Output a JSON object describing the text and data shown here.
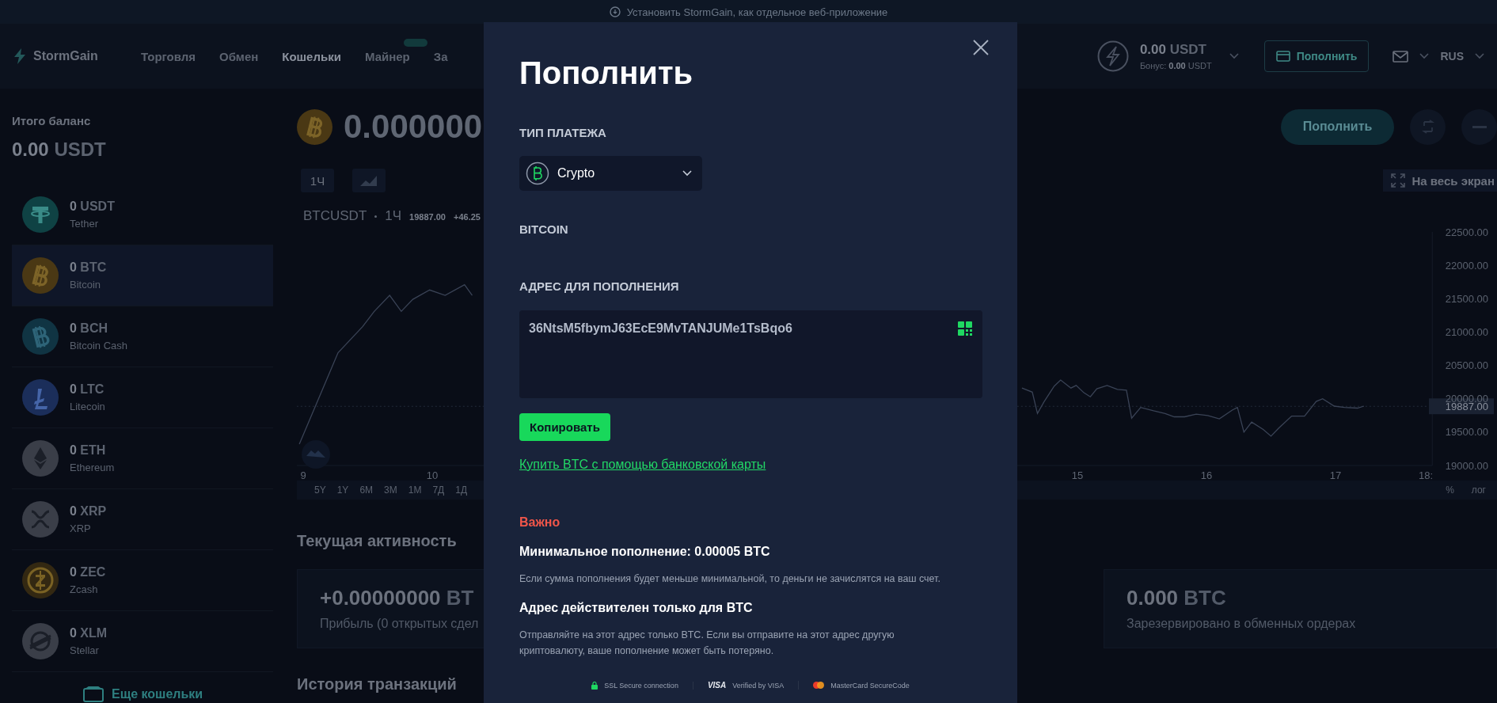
{
  "install_banner": {
    "text": "Установить StormGain, как отдельное веб-приложение"
  },
  "header": {
    "logo": "StormGain",
    "nav": [
      {
        "label": "Торговля",
        "selected": false,
        "badge": false
      },
      {
        "label": "Обмен",
        "selected": false,
        "badge": false
      },
      {
        "label": "Кошельки",
        "selected": true,
        "badge": false
      },
      {
        "label": "Майнер",
        "selected": false,
        "badge": true
      },
      {
        "label": "За",
        "selected": false,
        "badge": false
      }
    ],
    "balance": {
      "amount": "0.00",
      "currency": "USDT",
      "bonus_label": "Бонус:",
      "bonus_amount": "0.00",
      "bonus_currency": "USDT"
    },
    "deposit_button": "Пополнить",
    "language": "RUS"
  },
  "sidebar": {
    "title": "Итого баланс",
    "total_amount": "0.00",
    "total_currency": "USDT",
    "wallets": [
      {
        "amount": "0",
        "symbol": "USDT",
        "name": "Tether",
        "kind": "usdt",
        "selected": false
      },
      {
        "amount": "0",
        "symbol": "BTC",
        "name": "Bitcoin",
        "kind": "btc",
        "selected": true
      },
      {
        "amount": "0",
        "symbol": "BCH",
        "name": "Bitcoin Cash",
        "kind": "bch",
        "selected": false
      },
      {
        "amount": "0",
        "symbol": "LTC",
        "name": "Litecoin",
        "kind": "ltc",
        "selected": false
      },
      {
        "amount": "0",
        "symbol": "ETH",
        "name": "Ethereum",
        "kind": "eth",
        "selected": false
      },
      {
        "amount": "0",
        "symbol": "XRP",
        "name": "XRP",
        "kind": "xrp",
        "selected": false
      },
      {
        "amount": "0",
        "symbol": "ZEC",
        "name": "Zcash",
        "kind": "zec",
        "selected": false
      },
      {
        "amount": "0",
        "symbol": "XLM",
        "name": "Stellar",
        "kind": "xlm",
        "selected": false
      }
    ],
    "more_link": "Еще кошельки"
  },
  "main": {
    "asset_amount": "0.000000",
    "deposit_button": "Пополнить",
    "interval_tab": "1Ч",
    "fullscreen_button": "На весь экран",
    "chart_symbol": "BTCUSDT",
    "chart_interval": "1Ч",
    "chart_price": "19887.00",
    "chart_change": "+46.25",
    "chart_data": {
      "type": "line",
      "xlim": [
        8.95,
        17.75
      ],
      "ylim": [
        19000,
        22500
      ],
      "xticks": [
        9,
        10,
        15,
        16,
        17,
        {
          "value": 17.7,
          "label": "18:"
        }
      ],
      "yticks": [
        {
          "value": 19000,
          "label": "19000.00"
        },
        {
          "value": 19500,
          "label": "19500.00"
        },
        {
          "value": 20000,
          "label": "20000.00"
        },
        {
          "value": 20500,
          "label": "20500.00"
        },
        {
          "value": 21000,
          "label": "21000.00"
        },
        {
          "value": 21500,
          "label": "21500.00"
        },
        {
          "value": 22000,
          "label": "22000.00"
        },
        {
          "value": 22500,
          "label": "22500.00"
        }
      ],
      "x": [
        8.97,
        9.2,
        9.27,
        9.46,
        9.55,
        9.67,
        9.76,
        9.85,
        9.98,
        10.1,
        10.25,
        10.31,
        14.57,
        14.65,
        14.69,
        14.74,
        14.82,
        14.87,
        14.95,
        14.99,
        15.05,
        15.1,
        15.15,
        15.23,
        15.31,
        15.38,
        15.42,
        15.49,
        15.59,
        15.68,
        15.75,
        15.83,
        15.92,
        16.01,
        16.1,
        16.2,
        16.24,
        16.29,
        16.35,
        16.44,
        16.5,
        16.56,
        16.66,
        16.76,
        16.85,
        16.9,
        16.99,
        17.07,
        17.17,
        17.22
      ],
      "series": [
        {
          "color": "#3a4356",
          "values": [
            19320,
            20370,
            20690,
            21080,
            21310,
            21550,
            21310,
            21490,
            21630,
            21550,
            21710,
            21550,
            20160,
            20100,
            19780,
            19950,
            20190,
            20280,
            20160,
            20200,
            20090,
            20030,
            20150,
            20200,
            20140,
            20130,
            19710,
            19870,
            19820,
            19780,
            19730,
            19730,
            19770,
            19750,
            19700,
            19830,
            19870,
            19500,
            19650,
            19540,
            19440,
            19560,
            19740,
            19740,
            19960,
            20000,
            19890,
            19870,
            19860,
            19890
          ]
        }
      ],
      "ref_lines": [
        {
          "axis": "y",
          "value": 19887,
          "label": "19887.00"
        }
      ]
    },
    "ranges": [
      "5Y",
      "1Y",
      "6M",
      "3M",
      "1M",
      "7Д",
      "1Д"
    ],
    "scale_options": [
      "%",
      "лог"
    ],
    "activity_title": "Текущая активность",
    "activity_cards": [
      {
        "value": "+0.00000000",
        "unit": "BT",
        "caption": "Прибыль (0 открытых сдел"
      },
      {
        "value": "0.000",
        "unit": "BTC",
        "caption": "Зарезервировано в обменных ордерах"
      }
    ],
    "history_title": "История транзакций"
  },
  "modal": {
    "title": "Пополнить",
    "payment_type_label": "ТИП ПЛАТЕЖА",
    "payment_type": "Crypto",
    "currency_label": "BITCOIN",
    "address_label": "АДРЕС ДЛЯ ПОПОЛНЕНИЯ",
    "address": "36NtsM5fbymJ63EcE9MvTANJUMe1TsBqo6",
    "copy_button": "Копировать",
    "buy_link": "Купить BTC с помощью банковской карты",
    "important": "Важно",
    "notes": [
      {
        "title": "Минимальное пополнение: 0.00005 BTC",
        "text": "Если сумма пополнения будет меньше минимальной, то деньги не зачислятся на ваш счет."
      },
      {
        "title": "Адрес действителен только для BTC",
        "text": "Отправляйте на этот адрес только BTC. Если вы отправите на этот адрес другую криптовалюту, ваше пополнение может быть потеряно."
      }
    ],
    "security": [
      {
        "kind": "ssl",
        "text": "SSL Secure connection"
      },
      {
        "kind": "visa",
        "mark": "VISA",
        "text": "Verified by VISA"
      },
      {
        "kind": "mastercard",
        "text": "MasterCard SecureCode"
      }
    ]
  }
}
